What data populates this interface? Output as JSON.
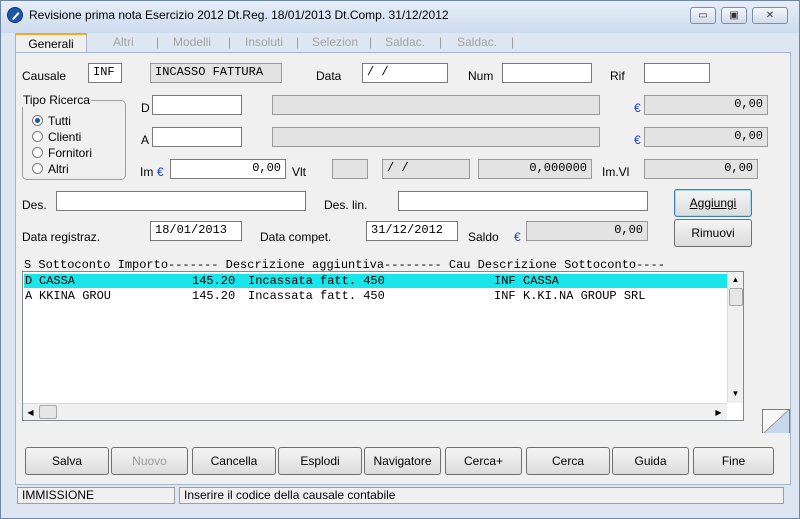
{
  "window": {
    "title": "Revisione prima nota  Esercizio 2012  Dt.Reg. 18/01/2013  Dt.Comp. 31/12/2012",
    "minimize": "▭",
    "maximize": "▣",
    "close": "✕"
  },
  "tabs": [
    {
      "label": "Generali"
    },
    {
      "label": "Altri"
    },
    {
      "label": "Modelli"
    },
    {
      "label": "Insoluti"
    },
    {
      "label": "Selezion"
    },
    {
      "label": "Saldac."
    },
    {
      "label": "Saldac."
    }
  ],
  "form": {
    "causale_label": "Causale",
    "causale_value": "INF",
    "causale_desc": "INCASSO FATTURA",
    "data_label": "Data",
    "data_value": "  /  /",
    "num_label": "Num",
    "num_value": "",
    "rif_label": "Rif",
    "rif_value": "",
    "tipo_ricerca_label": "Tipo Ricerca",
    "radio_options": [
      "Tutti",
      "Clienti",
      "Fornitori",
      "Altri"
    ],
    "radio_selected": "Tutti",
    "d_label": "D",
    "d_value": "",
    "d_desc": "",
    "d_amount": "0,00",
    "a_label": "A",
    "a_value": "",
    "a_desc": "",
    "a_amount": "0,00",
    "im_label": "Im",
    "im_value": "0,00",
    "vlt_label": "Vlt",
    "vlt_value": "",
    "vlt_date": "  /  /",
    "vlt_rate": "0,000000",
    "imvl_label": "Im.Vl",
    "imvl_value": "0,00",
    "euro_symbol": "€",
    "des_label": "Des.",
    "des_value": "",
    "deslin_label": "Des. lin.",
    "deslin_value": "",
    "data_registraz_label": "Data registraz.",
    "data_registraz_value": "18/01/2013",
    "data_compet_label": "Data compet.",
    "data_compet_value": "31/12/2012",
    "saldo_label": "Saldo",
    "saldo_value": "0,00",
    "aggiungi_label": "Aggiungi",
    "rimuovi_label": "Rimuovi"
  },
  "list": {
    "header": "S Sottoconto Importo------- Descrizione aggiuntiva-------- Cau Descrizione Sottoconto----",
    "rows": [
      {
        "s": "D",
        "sottoconto": "CASSA",
        "importo": "145.20",
        "descrizione": "Incassata fatt. 450",
        "cau": "INF",
        "desc_sottoconto": "CASSA"
      },
      {
        "s": "A",
        "sottoconto": "KKINA GROU",
        "importo": "145.20",
        "descrizione": "Incassata fatt. 450",
        "cau": "INF",
        "desc_sottoconto": "K.KI.NA GROUP SRL"
      }
    ],
    "selected_index": 0
  },
  "buttons": [
    {
      "label": "Salva",
      "disabled": false
    },
    {
      "label": "Nuovo",
      "disabled": true
    },
    {
      "label": "Cancella",
      "disabled": false
    },
    {
      "label": "Esplodi",
      "disabled": false
    },
    {
      "label": "Navigatore",
      "disabled": false
    },
    {
      "label": "Cerca+",
      "disabled": false
    },
    {
      "label": "Cerca",
      "disabled": false
    },
    {
      "label": "Guida",
      "disabled": false
    },
    {
      "label": "Fine",
      "disabled": false
    }
  ],
  "status": {
    "mode": "IMMISSIONE",
    "message": "Inserire il codice della causale contabile"
  },
  "colors": {
    "selected_row": "#19e6ea",
    "euro": "#1a3cc7",
    "tab_accent": "#f5a623"
  }
}
